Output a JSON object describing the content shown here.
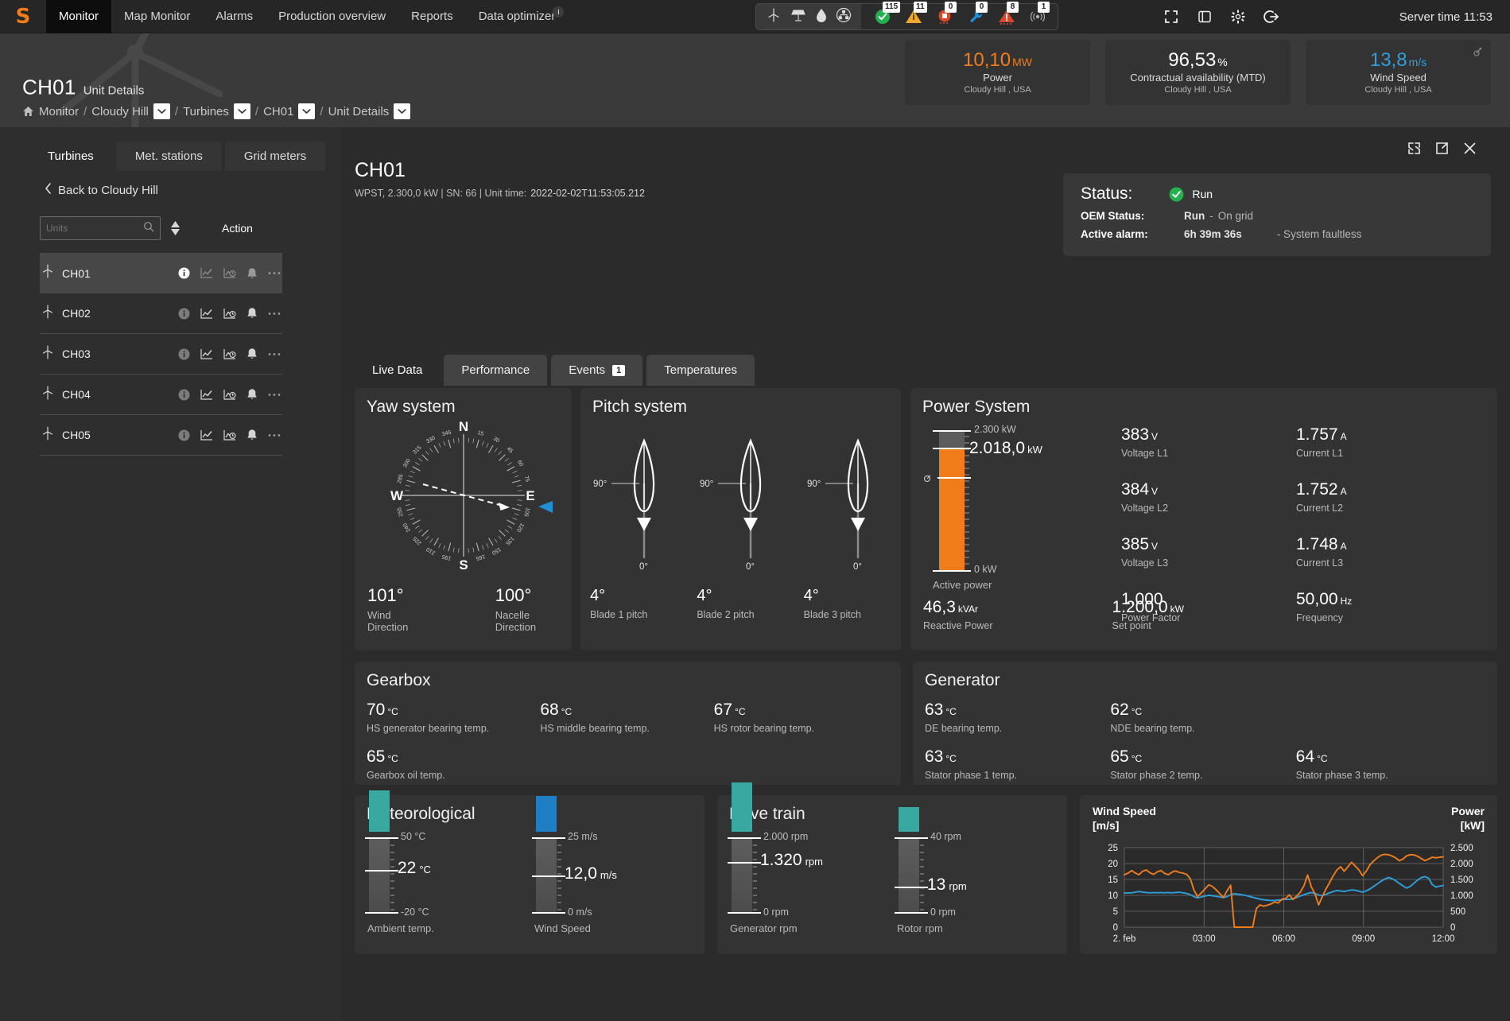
{
  "topnav": {
    "logo": "S",
    "items": [
      {
        "label": "Monitor",
        "active": true
      },
      {
        "label": "Map Monitor",
        "active": false
      },
      {
        "label": "Alarms",
        "active": false
      },
      {
        "label": "Production overview",
        "active": false
      },
      {
        "label": "Reports",
        "active": false
      },
      {
        "label": "Data optimizer",
        "active": false,
        "badge": "i"
      }
    ],
    "asset_icons": [
      "wind-turbine-icon",
      "solar-panel-icon",
      "water-drop-icon",
      "grid-network-icon"
    ],
    "alarm_counters": [
      {
        "icon": "check-circle-icon",
        "count": "115",
        "color": "#22b14c"
      },
      {
        "icon": "warning-triangle-icon",
        "count": "11",
        "color": "#f0a82c"
      },
      {
        "icon": "stop-circle-icon",
        "count": "0",
        "color": "#d9472b"
      },
      {
        "icon": "wrench-icon",
        "count": "0",
        "color": "#1f8fd6"
      },
      {
        "icon": "alert-triangle-icon",
        "count": "8",
        "color": "#d9472b"
      },
      {
        "icon": "signal-icon",
        "count": "1",
        "color": "#b0b0b0"
      }
    ],
    "window_controls": [
      "fullscreen-icon",
      "panel-icon",
      "gear-icon",
      "logout-icon"
    ],
    "server_time": "Server time 11:53"
  },
  "header": {
    "title": "CH01",
    "subtitle": "Unit Details",
    "breadcrumb": [
      {
        "label": "Monitor",
        "home": true,
        "dropdown": false
      },
      {
        "label": "Cloudy Hill",
        "dropdown": true
      },
      {
        "label": "Turbines",
        "dropdown": true
      },
      {
        "label": "CH01",
        "dropdown": true
      },
      {
        "label": "Unit Details",
        "dropdown": true
      }
    ],
    "kpis": [
      {
        "value": "10,10",
        "unit": "MW",
        "label": "Power",
        "location": "Cloudy Hill , USA",
        "color": "#f07d1a"
      },
      {
        "value": "96,53",
        "unit": "%",
        "label": "Contractual availability (MTD)",
        "location": "Cloudy Hill , USA",
        "color": "#ffffff"
      },
      {
        "value": "13,8",
        "unit": "m/s",
        "label": "Wind Speed",
        "location": "Cloudy Hill , USA",
        "color": "#2f9fdc"
      }
    ]
  },
  "sidebar": {
    "tabs": [
      {
        "label": "Turbines",
        "active": true
      },
      {
        "label": "Met. stations",
        "active": false
      },
      {
        "label": "Grid meters",
        "active": false
      }
    ],
    "back_label": "Back to Cloudy Hill",
    "search_placeholder": "Units",
    "search_value": "",
    "action_header": "Action",
    "units": [
      {
        "name": "CH01",
        "selected": true
      },
      {
        "name": "CH02",
        "selected": false
      },
      {
        "name": "CH03",
        "selected": false
      },
      {
        "name": "CH04",
        "selected": false
      },
      {
        "name": "CH05",
        "selected": false
      }
    ],
    "row_icons": [
      "info-icon",
      "chart-line-icon",
      "chart-clock-icon",
      "bell-icon",
      "more-icon"
    ]
  },
  "main": {
    "panel_controls": [
      "expand-icon",
      "popout-icon",
      "close-icon"
    ],
    "unit_title": "CH01",
    "unit_meta_prefix": "WPST, 2.300,0 kW | SN: 66 | Unit time:",
    "unit_meta_time": "2022-02-02T11:53:05.212",
    "status": {
      "status_label": "Status:",
      "status_value": "Run",
      "status_color": "#22b14c",
      "oem_label": "OEM Status:",
      "oem_value": "Run",
      "oem_dash": "-",
      "oem_detail": "On grid",
      "alarm_label": "Active alarm:",
      "alarm_duration": "6h 39m 36s",
      "alarm_detail": "- System faultless"
    },
    "tabs": [
      {
        "label": "Live Data",
        "active": true,
        "badge": null
      },
      {
        "label": "Performance",
        "active": false,
        "badge": null
      },
      {
        "label": "Events",
        "active": false,
        "badge": "1"
      },
      {
        "label": "Temperatures",
        "active": false,
        "badge": null
      }
    ],
    "yaw": {
      "title": "Yaw system",
      "compass_labels": [
        "N",
        "E",
        "S",
        "W"
      ],
      "tick_labels": [
        "15",
        "30",
        "45",
        "60",
        "75",
        "105",
        "120",
        "135",
        "150",
        "165",
        "195",
        "210",
        "225",
        "240",
        "255",
        "285",
        "300",
        "315",
        "330",
        "345"
      ],
      "wind_direction_value": "101°",
      "wind_direction_label": "Wind Direction",
      "nacelle_direction_value": "100°",
      "nacelle_direction_label": "Nacelle Direction",
      "nacelle_marker_color": "#1f8fd6"
    },
    "pitch": {
      "title": "Pitch system",
      "top_scale": "90°",
      "bottom_scale": "0°",
      "blades": [
        {
          "value": "4°",
          "label": "Blade 1 pitch"
        },
        {
          "value": "4°",
          "label": "Blade 2 pitch"
        },
        {
          "value": "4°",
          "label": "Blade 3 pitch"
        }
      ]
    },
    "power_system": {
      "title": "Power System",
      "gauge": {
        "max_label": "2.300 kW",
        "min_label": "0 kW",
        "value_label": "2.018,0",
        "value_unit": "kW",
        "caption": "Active power",
        "max": 2300,
        "value": 2018,
        "setpoint_marker": 1200,
        "color": "#f07d1a"
      },
      "metrics": [
        {
          "value": "383",
          "unit": "V",
          "label": "Voltage L1"
        },
        {
          "value": "1.757",
          "unit": "A",
          "label": "Current L1"
        },
        {
          "value": "384",
          "unit": "V",
          "label": "Voltage L2"
        },
        {
          "value": "1.752",
          "unit": "A",
          "label": "Current L2"
        },
        {
          "value": "385",
          "unit": "V",
          "label": "Voltage L3"
        },
        {
          "value": "1.748",
          "unit": "A",
          "label": "Current L3"
        },
        {
          "value": "1,000",
          "unit": "",
          "label": "Power Factor"
        },
        {
          "value": "50,00",
          "unit": "Hz",
          "label": "Frequency"
        }
      ],
      "bottom": [
        {
          "value": "46,3",
          "unit": "kVAr",
          "label": "Reactive Power"
        },
        {
          "value": "1.200,0",
          "unit": "kW",
          "label": "Set point"
        }
      ]
    },
    "gearbox": {
      "title": "Gearbox",
      "metrics": [
        {
          "value": "70",
          "unit": "°C",
          "label": "HS generator bearing temp."
        },
        {
          "value": "68",
          "unit": "°C",
          "label": "HS middle bearing temp."
        },
        {
          "value": "67",
          "unit": "°C",
          "label": "HS rotor bearing temp."
        },
        {
          "value": "65",
          "unit": "°C",
          "label": "Gearbox oil temp."
        }
      ]
    },
    "generator": {
      "title": "Generator",
      "metrics": [
        {
          "value": "63",
          "unit": "°C",
          "label": "DE bearing temp."
        },
        {
          "value": "62",
          "unit": "°C",
          "label": "NDE bearing temp."
        },
        {
          "value": "63",
          "unit": "°C",
          "label": "Stator phase 1 temp."
        },
        {
          "value": "65",
          "unit": "°C",
          "label": "Stator phase 2 temp."
        },
        {
          "value": "64",
          "unit": "°C",
          "label": "Stator phase 3 temp."
        }
      ]
    },
    "meteorological": {
      "title": "Meteorological",
      "gauges": [
        {
          "max_label": "50 °C",
          "min_label": "-20 °C",
          "value_label": "22",
          "value_unit": "°C",
          "caption": "Ambient temp.",
          "min": -20,
          "max": 50,
          "value": 22,
          "color": "#38a8a0"
        },
        {
          "max_label": "25 m/s",
          "min_label": "0 m/s",
          "value_label": "12,0",
          "value_unit": "m/s",
          "caption": "Wind Speed",
          "min": 0,
          "max": 25,
          "value": 12,
          "color": "#1f7fc4"
        }
      ]
    },
    "drivetrain": {
      "title": "Drive train",
      "gauges": [
        {
          "max_label": "2.000 rpm",
          "min_label": "0 rpm",
          "value_label": "1.320",
          "value_unit": "rpm",
          "caption": "Generator rpm",
          "min": 0,
          "max": 2000,
          "value": 1320,
          "color": "#38a8a0"
        },
        {
          "max_label": "40 rpm",
          "min_label": "0 rpm",
          "value_label": "13",
          "value_unit": "rpm",
          "caption": "Rotor rpm",
          "min": 0,
          "max": 40,
          "value": 13,
          "color": "#38a8a0"
        }
      ]
    }
  },
  "chart_data": {
    "type": "line",
    "title": "",
    "left_title": "Wind Speed\n[m/s]",
    "left_title_line1": "Wind Speed",
    "left_title_line2": "[m/s]",
    "right_title_line1": "Power",
    "right_title_line2": "[kW]",
    "ylabel": "Wind Speed [m/s]",
    "y2label": "Power [kW]",
    "ylim": [
      0,
      25
    ],
    "y2lim": [
      0,
      2500
    ],
    "yticks": [
      "0",
      "5",
      "10",
      "15",
      "20",
      "25"
    ],
    "y2ticks": [
      "0",
      "500",
      "1.000",
      "1.500",
      "2.000",
      "2.500"
    ],
    "xlabel": "",
    "xticks": [
      "2. feb",
      "03:00",
      "06:00",
      "09:00",
      "12:00"
    ],
    "grid": true,
    "legend": "none",
    "series": [
      {
        "name": "Wind Speed",
        "color": "#2f9fdc",
        "axis": "left",
        "unit": "m/s",
        "values": [
          10.7,
          10.8,
          10.8,
          11.0,
          11.2,
          11.0,
          10.9,
          10.8,
          10.9,
          10.8,
          10.9,
          10.8,
          10.9,
          10.8,
          10.9,
          11.0,
          10.8,
          10.6,
          10.2,
          9.6,
          9.2,
          9.5,
          9.8,
          10.0,
          9.9,
          9.7,
          9.5,
          9.3,
          9.6,
          10.2,
          10.5,
          10.4,
          10.2,
          10.0,
          9.7,
          9.4,
          9.1,
          8.8,
          8.6,
          8.5,
          8.4,
          8.4,
          8.5,
          8.6,
          8.8,
          8.7,
          9.0,
          9.3,
          9.8,
          10.2,
          10.6,
          10.9,
          10.6,
          10.1,
          9.9,
          10.3,
          10.8,
          11.2,
          11.5,
          11.4,
          11.2,
          11.5,
          11.7,
          11.6,
          11.3,
          11.0,
          11.4,
          12.0,
          12.8,
          13.6,
          14.4,
          15.1,
          15.6,
          15.3,
          14.6,
          13.8,
          13.0,
          12.3,
          12.8,
          13.8,
          14.8,
          15.6,
          15.9,
          15.4,
          13.4,
          12.6,
          12.9,
          13.1
        ]
      },
      {
        "name": "Power",
        "color": "#ef7d1a",
        "axis": "right",
        "unit": "kW",
        "values": [
          1650,
          1700,
          1780,
          1700,
          1650,
          1760,
          1800,
          1710,
          1660,
          1740,
          1780,
          1690,
          1650,
          1730,
          1770,
          1720,
          1700,
          1660,
          1520,
          1160,
          960,
          1080,
          1200,
          1330,
          1280,
          1180,
          1060,
          930,
          1140,
          1320,
          0,
          0,
          0,
          0,
          0,
          0,
          580,
          700,
          660,
          690,
          730,
          790,
          760,
          880,
          900,
          1020,
          870,
          980,
          1100,
          1300,
          1640,
          1270,
          1050,
          700,
          960,
          1200,
          1400,
          1620,
          1800,
          1900,
          1760,
          1900,
          2040,
          1920,
          1800,
          1620,
          1760,
          1960,
          2080,
          2180,
          2260,
          2290,
          2280,
          2240,
          2180,
          2090,
          2140,
          2240,
          2280,
          2270,
          2230,
          2160,
          2090,
          2140,
          2200,
          2180,
          2200,
          2210
        ]
      }
    ]
  }
}
